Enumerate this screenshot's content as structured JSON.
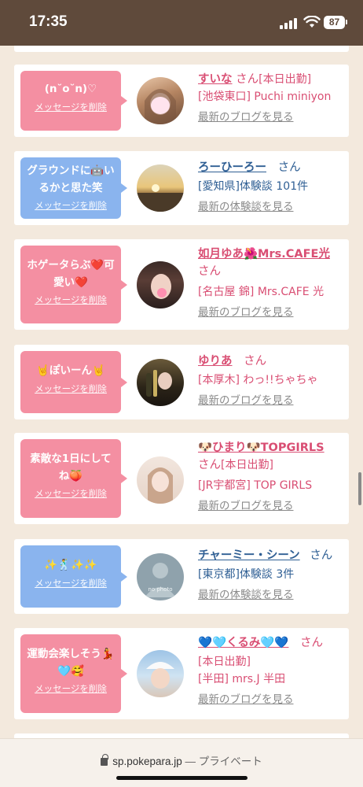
{
  "status_bar": {
    "time": "17:35",
    "battery": "87"
  },
  "colors": {
    "pink": "#f48fa2",
    "blue": "#8ab4ee",
    "name_pink": "#d94e73",
    "name_blue": "#2f5f94"
  },
  "delete_label": "メッセージを削除",
  "cards": [
    {
      "message": "(n˘o˘n)♡",
      "bubble_color": "pink",
      "name": "すいな",
      "san": "さん",
      "lines": [
        "[本日出勤]",
        "[池袋東口] Puchi miniyon"
      ],
      "link": "最新のブログを見る"
    },
    {
      "message": "グラウンドに🤖いるかと思た笑",
      "bubble_color": "blue",
      "name": "ろーひーろー",
      "san": "さん",
      "lines": [
        "[愛知県]体験談 101件"
      ],
      "link": "最新の体験談を見る"
    },
    {
      "message": "ホゲータらぶ❤️可愛い❤️",
      "bubble_color": "pink",
      "name": "如月ゆあ🌺Mrs.CAFE光",
      "san": "さん",
      "lines": [
        "[名古屋 錦] Mrs.CAFE 光"
      ],
      "link": "最新のブログを見る"
    },
    {
      "message": "🤘ぽいーん🤘",
      "bubble_color": "pink",
      "name": "ゆりあ",
      "san": "さん",
      "lines": [
        "[本厚木] わっ!!ちゃちゃ"
      ],
      "link": "最新のブログを見る"
    },
    {
      "message": "素敵な1日にしてね🍑",
      "bubble_color": "pink",
      "name": "🐶ひまり🐶TOPGIRLS",
      "san": "さん",
      "lines": [
        "[本日出勤]",
        "[JR宇都宮] TOP GIRLS"
      ],
      "link": "最新のブログを見る"
    },
    {
      "message": "✨🕺✨✨",
      "bubble_color": "blue",
      "name": "チャーミー・シーン",
      "san": "さん",
      "lines": [
        "[東京都]体験談 3件"
      ],
      "link": "最新の体験談を見る"
    },
    {
      "message": "運動会楽しそう💃🩵🥰",
      "bubble_color": "pink",
      "name": "💙🩵くるみ🩵💙",
      "san": "さん",
      "lines": [
        "[本日出勤]",
        "[半田] mrs.J 半田"
      ],
      "link": "最新のブログを見る"
    }
  ],
  "avatar_text": {
    "no_photo": "no photo"
  },
  "url_bar": {
    "domain": "sp.pokepara.jp",
    "suffix": "— プライベート"
  }
}
